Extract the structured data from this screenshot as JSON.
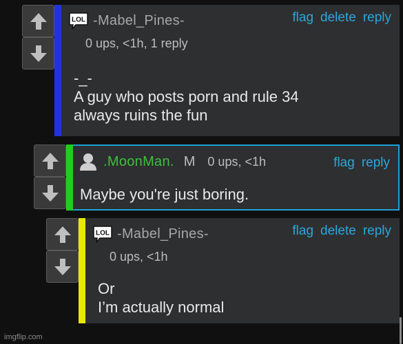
{
  "colors": {
    "background": "#101010",
    "panel": "#2e2f31",
    "link": "#2ba7dc",
    "bar_blue": "#2233dd",
    "bar_green": "#22cc22",
    "bar_yellow": "#e8e800",
    "moonman_name": "#3fbf3f"
  },
  "comments": [
    {
      "avatar_icon": "lol-icon",
      "avatar_text": "LOL",
      "username": "-Mabel_Pines-",
      "stats": "0 ups, <1h, 1 reply",
      "actions": [
        "flag",
        "delete",
        "reply"
      ],
      "text": "-_-\nA guy who posts porn and rule 34\nalways ruins the fun"
    },
    {
      "avatar_icon": "user-icon",
      "username": ".MoonMan.",
      "badge": "M",
      "stats": "0 ups, <1h",
      "actions": [
        "flag",
        "reply"
      ],
      "text": "Maybe you're just boring."
    },
    {
      "avatar_icon": "lol-icon",
      "avatar_text": "LOL",
      "username": "-Mabel_Pines-",
      "stats": "0 ups, <1h",
      "actions": [
        "flag",
        "delete",
        "reply"
      ],
      "text": "Or\nI’m actually normal"
    }
  ],
  "watermark": "imgflip.com"
}
